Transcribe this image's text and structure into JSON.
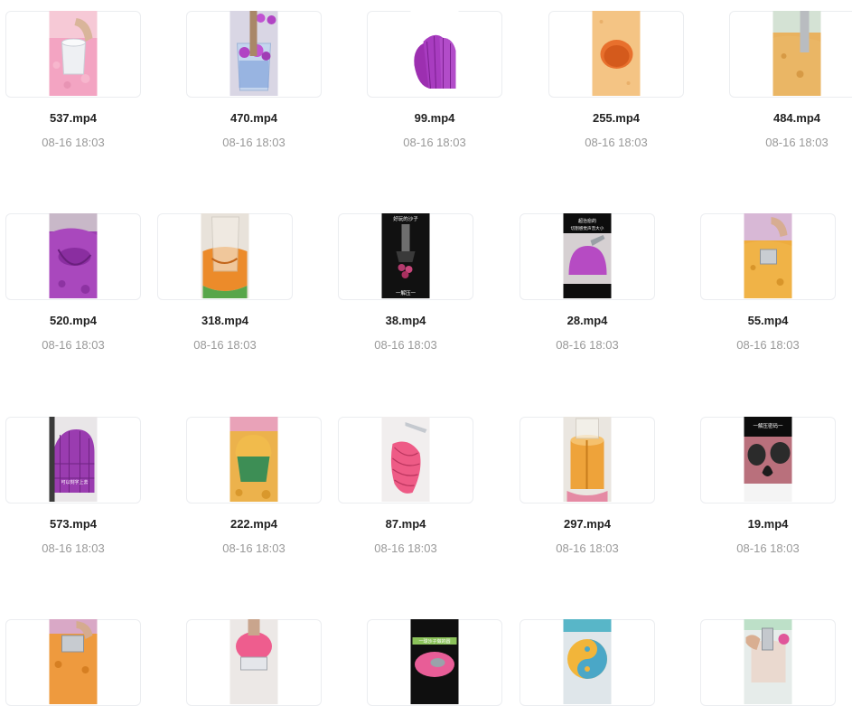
{
  "files": [
    {
      "name": "537.mp4",
      "date": "08-16 18:03",
      "thumb": "pink-sand-cup-icon"
    },
    {
      "name": "470.mp4",
      "date": "08-16 18:03",
      "thumb": "glass-purple-balls-icon"
    },
    {
      "name": "99.mp4",
      "date": "08-16 18:03",
      "thumb": "purple-slices-icon"
    },
    {
      "name": "255.mp4",
      "date": "08-16 18:03",
      "thumb": "sand-hole-icon"
    },
    {
      "name": "484.mp4",
      "date": "08-16 18:03",
      "thumb": "orange-sand-tube-icon"
    },
    {
      "name": "520.mp4",
      "date": "08-16 18:03",
      "thumb": "purple-mound-icon"
    },
    {
      "name": "318.mp4",
      "date": "08-16 18:03",
      "thumb": "orange-glass-icon"
    },
    {
      "name": "38.mp4",
      "date": "08-16 18:03",
      "thumb": "dark-press-icon"
    },
    {
      "name": "28.mp4",
      "date": "08-16 18:03",
      "thumb": "purple-dome-knife-icon"
    },
    {
      "name": "55.mp4",
      "date": "08-16 18:03",
      "thumb": "orange-sand-press-icon"
    },
    {
      "name": "573.mp4",
      "date": "08-16 18:03",
      "thumb": "purple-cube-icon"
    },
    {
      "name": "222.mp4",
      "date": "08-16 18:03",
      "thumb": "orange-green-cake-icon"
    },
    {
      "name": "87.mp4",
      "date": "08-16 18:03",
      "thumb": "pink-slices-icon"
    },
    {
      "name": "297.mp4",
      "date": "08-16 18:03",
      "thumb": "orange-cylinder-icon"
    },
    {
      "name": "19.mp4",
      "date": "08-16 18:03",
      "thumb": "dark-sponge-icon"
    },
    {
      "name": "",
      "date": "",
      "thumb": "orange-sand-mold-icon"
    },
    {
      "name": "",
      "date": "",
      "thumb": "pink-cylinder-icon"
    },
    {
      "name": "",
      "date": "",
      "thumb": "dark-pink-scoop-icon"
    },
    {
      "name": "",
      "date": "",
      "thumb": "yin-yang-icon"
    },
    {
      "name": "",
      "date": "",
      "thumb": "hand-mold-icon"
    }
  ],
  "thumb_text": {
    "t38_top": "好玩的沙子",
    "t38_bottom": "一解压一",
    "t28_top1": "超治愈的",
    "t28_top2": "切割感觉声音大小",
    "t573_caption": "可以刻字上去",
    "t19_top": "一解压密码一",
    "t_scoop_banner": "一球沙子做的圆"
  }
}
